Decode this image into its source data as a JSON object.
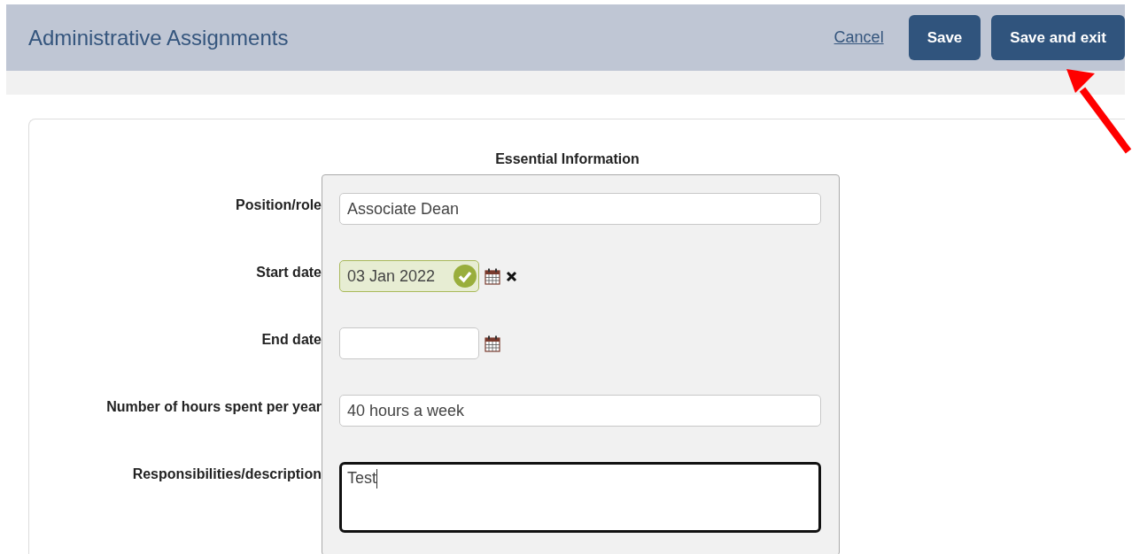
{
  "header": {
    "title": "Administrative Assignments",
    "cancel": "Cancel",
    "buttons": [
      "Save",
      "Save and exit"
    ]
  },
  "section": {
    "title": "Essential Information"
  },
  "fields": [
    {
      "kind": "text",
      "label": "Position/role",
      "value": "Associate Dean",
      "focused": false
    },
    {
      "kind": "date",
      "label": "Start date",
      "value": "03 Jan 2022",
      "valid": true,
      "clearable": true
    },
    {
      "kind": "date",
      "label": "End date",
      "valid": false,
      "clearable": false
    },
    {
      "kind": "text",
      "label": "Number of hours spent per year",
      "value": "40 hours a week",
      "focused": false
    },
    {
      "kind": "textarea",
      "label": "Responsibilities/description",
      "value": "Test",
      "focused": true
    }
  ],
  "annotation": {
    "kind": "arrow"
  }
}
